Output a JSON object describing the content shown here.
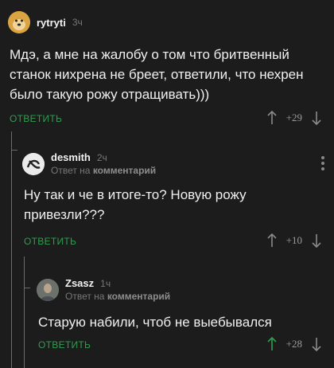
{
  "comments": [
    {
      "username": "rytryti",
      "time": "3ч",
      "text": "Мдэ, а мне на жалобу о том что бритвенный станок нихрена не бреет, ответили, что нехрен было такую рожу отращивать)))",
      "reply_label": "ОТВЕТИТЬ",
      "rating": "+29",
      "upvote_color": "#8a8a8a"
    },
    {
      "username": "desmith",
      "time": "2ч",
      "reply_to_prefix": "Ответ на",
      "reply_to_target": "комментарий",
      "text": "Ну так и че в итоге-то? Новую рожу привезли???",
      "reply_label": "ОТВЕТИТЬ",
      "rating": "+10",
      "upvote_color": "#8a8a8a"
    },
    {
      "username": "Zsasz",
      "time": "1ч",
      "reply_to_prefix": "Ответ на",
      "reply_to_target": "комментарий",
      "text": "Старую набили, чтоб не выебывался",
      "reply_label": "ОТВЕТИТЬ",
      "rating": "+28",
      "upvote_color": "#2e9e4e"
    }
  ],
  "colors": {
    "background": "#1c1c1c",
    "accent_green": "#2e9e4e",
    "muted": "#777777"
  }
}
